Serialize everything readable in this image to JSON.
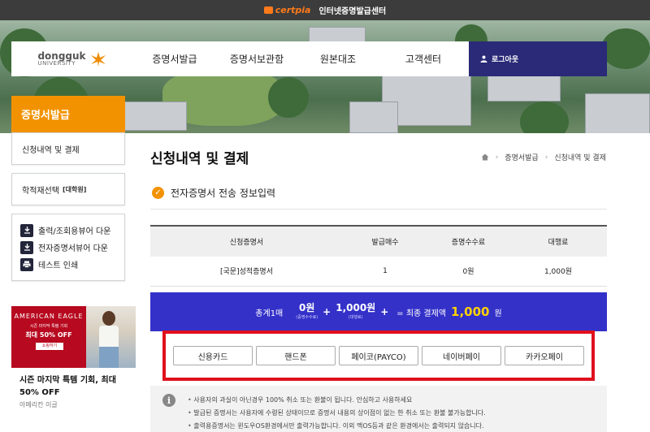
{
  "topbar": {
    "logo": "certpia",
    "title": "인터넷증명발급센터"
  },
  "nav": {
    "brand_line1": "dongguk",
    "brand_line2": "UNIVERSITY",
    "menu": [
      "증명서발급",
      "증명서보관함",
      "원본대조",
      "고객센터"
    ],
    "logout": "로그아웃"
  },
  "sidebar": {
    "title": "증명서발급",
    "current_item": "신청내역 및 결제",
    "record_label": "학적재선택",
    "record_tag": "[대학원]",
    "links": [
      "출력/조회용뷰어 다운",
      "전자증명서뷰어 다운",
      "테스트 인쇄"
    ]
  },
  "ad": {
    "brand": "AMERICAN EAGLE",
    "sub": "시즌 마지막 특템 기회",
    "off": "최대 50% OFF",
    "button": "쇼핑하기",
    "title": "시즌 마지막 특템 기회, 최대 50% OFF",
    "source": "아메리칸 이글"
  },
  "page": {
    "title": "신청내역 및 결제",
    "breadcrumb": [
      "증명서발급",
      "신청내역 및 결제"
    ],
    "section_heading": "전자증명서 전송 정보입력"
  },
  "table": {
    "headers": [
      "신청증명서",
      "발급매수",
      "증명수수료",
      "대행료"
    ],
    "rows": [
      [
        "[국문]성적증명서",
        "1",
        "0원",
        "1,000원"
      ]
    ]
  },
  "total": {
    "label": "총계1매",
    "fee": "0원",
    "fee_caption": "(증명수수료)",
    "agency": "1,000원",
    "agency_caption": "(대행료)",
    "final_label": "= 최종 결제액",
    "final_value": "1,000",
    "final_unit": "원"
  },
  "payment_methods": [
    "신용카드",
    "핸드폰",
    "페이코(PAYCO)",
    "네이버페이",
    "카카오페이"
  ],
  "notices": [
    "사용자의 과실이 아닌경우 100% 취소 또는 환불이 됩니다. 안심하고 사용하세요",
    "발급된 증명서는 사용자에 수령된 상태이므로 증명서 내용의 상이점이 없는 한 취소 또는 환불 불가능합니다.",
    "출력용증명서는 윈도우OS환경에서만 출력가능합니다. 이외 맥OS등과 같은 환경에서는 출력되지 않습니다."
  ],
  "colors": {
    "accent": "#f39200",
    "nav_dark": "#2a2a78",
    "total_bg": "#3431c9",
    "highlight": "#e0101e"
  }
}
